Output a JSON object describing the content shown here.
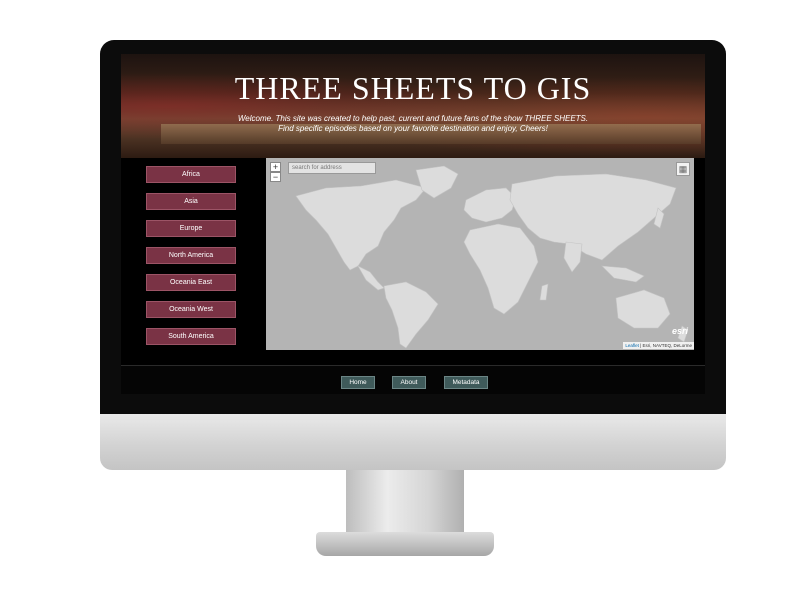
{
  "header": {
    "title": "THREE SHEETS TO GIS",
    "welcome_line1": "Welcome. This site was created to help past, current and future fans of the show THREE SHEETS.",
    "welcome_line2": "Find specific episodes based on your favorite destination and enjoy, Cheers!"
  },
  "sidebar": {
    "regions": [
      {
        "label": "Africa"
      },
      {
        "label": "Asia"
      },
      {
        "label": "Europe"
      },
      {
        "label": "North America"
      },
      {
        "label": "Oceania East"
      },
      {
        "label": "Oceania West"
      },
      {
        "label": "South America"
      }
    ]
  },
  "map": {
    "zoom_in": "+",
    "zoom_out": "−",
    "search_placeholder": "search for address",
    "logo": "esri",
    "attribution_link": "Leaflet",
    "attribution_text": "| Esri, NAVTEQ, DeLorme",
    "layers_icon": "layers-icon"
  },
  "footer": {
    "nav": [
      {
        "label": "Home"
      },
      {
        "label": "About"
      },
      {
        "label": "Metadata"
      }
    ]
  },
  "colors": {
    "region_button": "#7a3345",
    "nav_button": "#3f5a5a",
    "map_water": "#b4b4b4",
    "map_land": "#dcdcdc"
  }
}
